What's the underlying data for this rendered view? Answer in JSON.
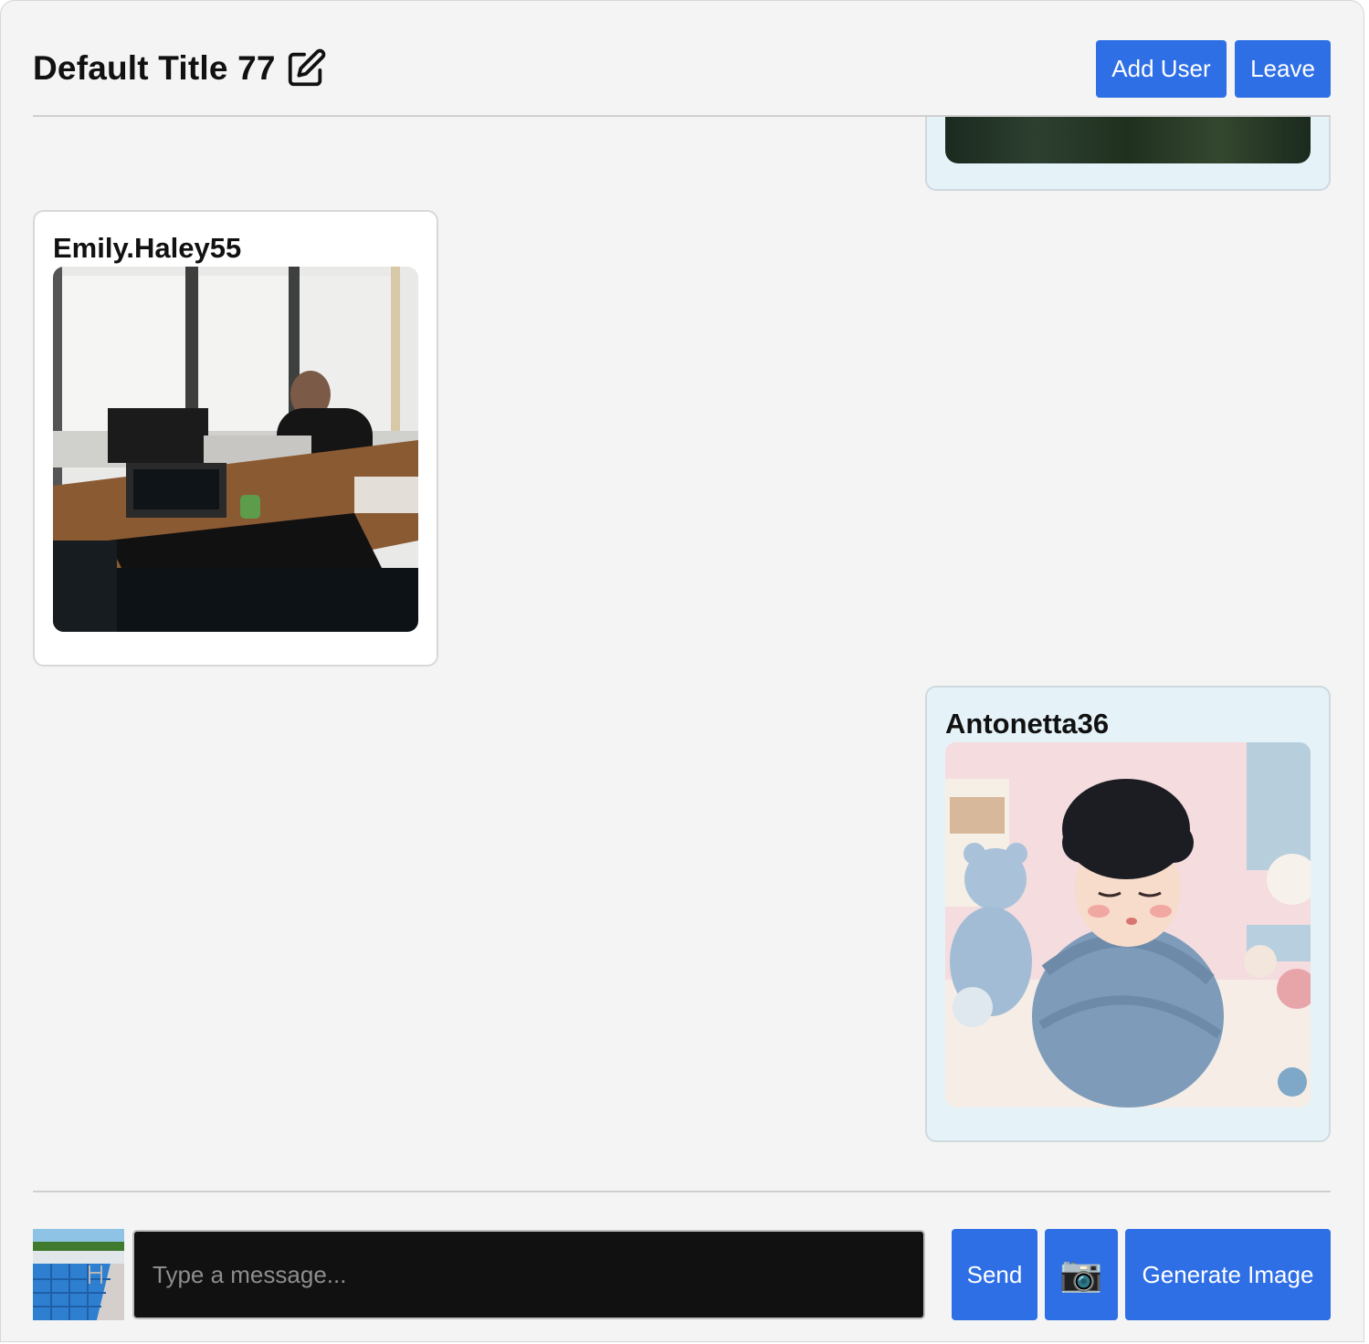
{
  "header": {
    "title": "Default Title 77",
    "add_user_label": "Add User",
    "leave_label": "Leave"
  },
  "messages": [
    {
      "user": "",
      "image": "dark-foliage-photo",
      "align": "right",
      "partial": true
    },
    {
      "user": "Emily.Haley55",
      "image": "office-desk-photo",
      "align": "left"
    },
    {
      "user": "Antonetta36",
      "image": "swaddled-baby-illustration",
      "align": "right"
    }
  ],
  "composer": {
    "thumbnail": "pool-photo",
    "placeholder": "Type a message...",
    "value": "",
    "send_label": "Send",
    "camera_icon": "📷",
    "generate_label": "Generate Image"
  },
  "colors": {
    "accent": "#2f6fe6",
    "self_bubble": "#e5f3f9",
    "other_bubble": "#ffffff",
    "background": "#f4f4f4"
  }
}
